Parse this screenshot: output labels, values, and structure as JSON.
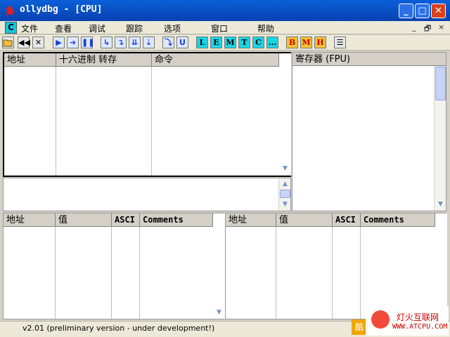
{
  "window": {
    "title": "ollydbg - [CPU]",
    "minimize": "_",
    "maximize": "□",
    "close": "✕"
  },
  "menubar": {
    "cpu_label": "C",
    "items": [
      "文件",
      "查看",
      "调试",
      "跟踪",
      "选项",
      "窗口",
      "帮助"
    ],
    "mdi": [
      "_",
      "🗗",
      "×"
    ]
  },
  "toolbar": {
    "letters": [
      "L",
      "E",
      "M",
      "T",
      "C",
      "...",
      "B",
      "M",
      "H"
    ]
  },
  "disasm": {
    "columns": [
      "地址",
      "十六进制 转存",
      "命令"
    ]
  },
  "registers": {
    "header": "寄存器 (FPU)"
  },
  "dump": {
    "columns": [
      "地址",
      "值",
      "ASCI",
      "Comments"
    ]
  },
  "stack": {
    "columns": [
      "地址",
      "值",
      "ASCI",
      "Comments"
    ]
  },
  "status": {
    "text": "v2.01 (preliminary version - under development!)"
  },
  "watermark": {
    "line1": "灯火互联网",
    "line2": "WWW.ATCPU.COM",
    "tag": "酷"
  }
}
